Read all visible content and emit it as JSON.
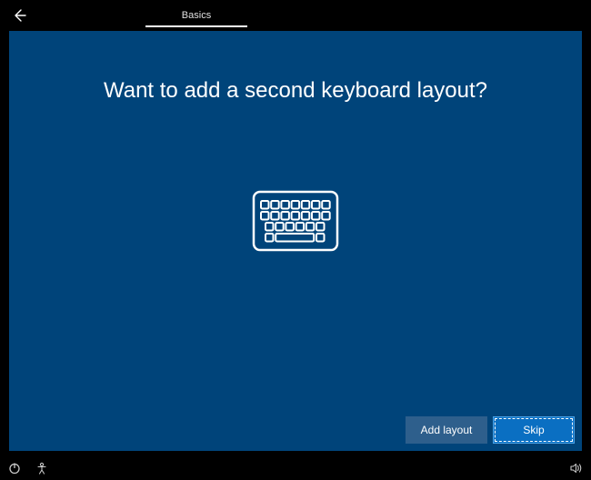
{
  "topbar": {
    "back_icon": "back-arrow-icon",
    "tab_label": "Basics"
  },
  "main": {
    "title": "Want to add a second keyboard layout?",
    "illustration": "keyboard-icon"
  },
  "actions": {
    "secondary_label": "Add layout",
    "primary_label": "Skip"
  },
  "sysbar": {
    "power_icon": "power-icon",
    "ease_icon": "ease-of-access-icon",
    "volume_icon": "volume-icon"
  },
  "colors": {
    "background": "#000000",
    "panel": "#00447a",
    "btn_secondary": "#2e5f8c",
    "btn_primary": "#0a6fc2"
  }
}
